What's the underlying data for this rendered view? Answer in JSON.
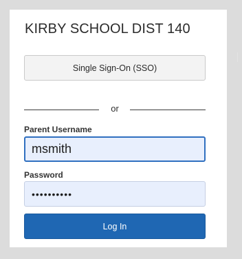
{
  "school": {
    "name": "KIRBY SCHOOL DIST 140"
  },
  "sso": {
    "label": "Single Sign-On (SSO)"
  },
  "divider": {
    "text": "or"
  },
  "username": {
    "label": "Parent Username",
    "value": "msmith"
  },
  "password": {
    "label": "Password",
    "value": "••••••••••"
  },
  "login": {
    "label": "Log In"
  },
  "colors": {
    "primary": "#1f67b3",
    "focus_border": "#2f6fc0",
    "input_fill": "#e8effd",
    "page_background": "#dcdcdc"
  }
}
